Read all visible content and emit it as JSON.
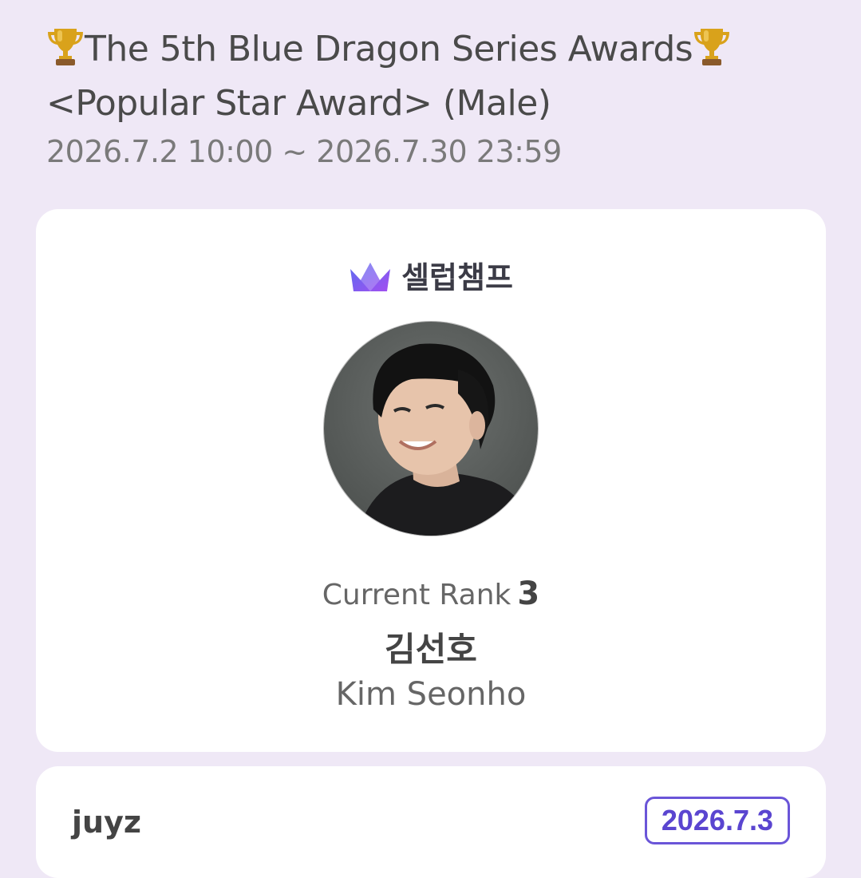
{
  "header": {
    "title_line1": "The 5th Blue Dragon Series Awards",
    "title_line2": "<Popular Star Award> (Male)",
    "period": "2026.7.2 10:00 ~ 2026.7.30 23:59"
  },
  "card": {
    "brand_name": "셀럽챔프",
    "rank_label": "Current Rank",
    "rank_value": "3",
    "name_korean": "김선호",
    "name_english": "Kim Seonho"
  },
  "entry": {
    "username": "juyz",
    "date": "2026.7.3"
  },
  "colors": {
    "background": "#efe8f6",
    "card": "#ffffff",
    "accent": "#5a45d0",
    "crown_gradient": [
      "#5b6cf0",
      "#a34ff0"
    ]
  },
  "icons": [
    "trophy-icon",
    "crown-icon"
  ]
}
